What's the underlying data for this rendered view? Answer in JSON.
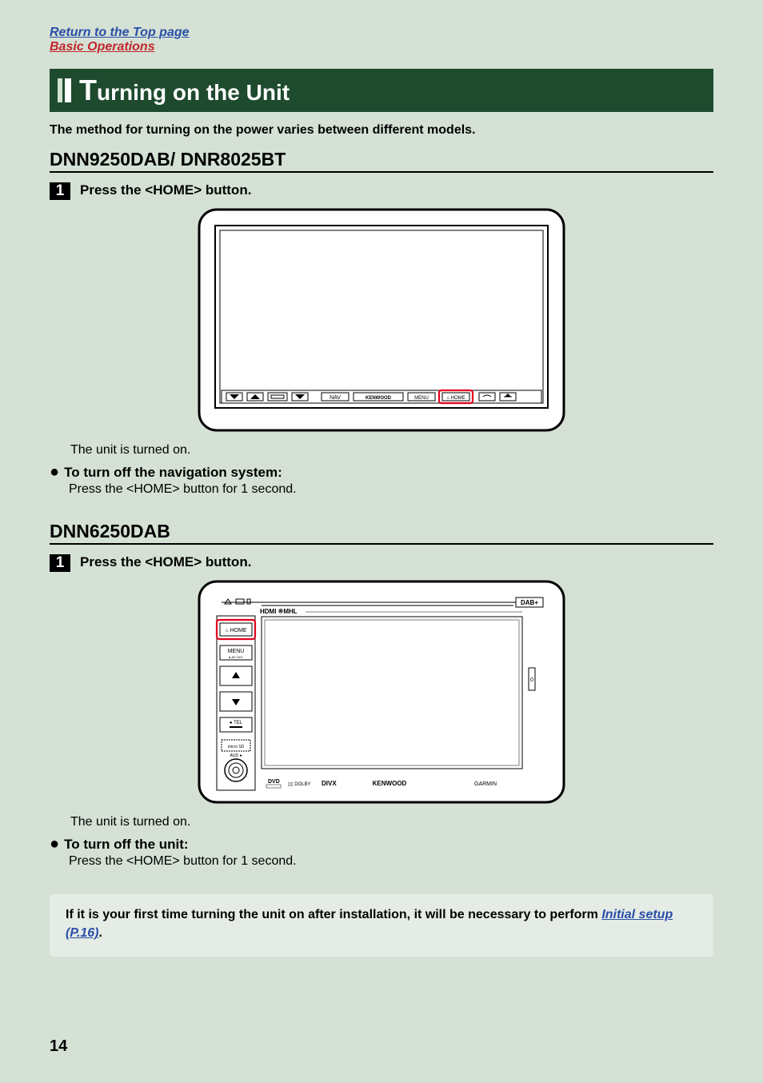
{
  "links": {
    "top_page": "Return to the Top page",
    "basic_ops": "Basic Operations"
  },
  "title": {
    "dropcap": "T",
    "rest": "urning on the Unit"
  },
  "intro": "The method for turning on the power varies between different models.",
  "section1": {
    "heading": "DNN9250DAB/ DNR8025BT",
    "step_num": "1",
    "step_text": "Press the <HOME> button.",
    "result": "The unit is turned on.",
    "bullet_heading": "To turn off the navigation system:",
    "bullet_sub": "Press the <HOME> button for 1 second.",
    "device": {
      "buttons": [
        "NAV",
        "KENWOOD",
        "MENU",
        "HOME"
      ]
    }
  },
  "section2": {
    "heading": "DNN6250DAB",
    "step_num": "1",
    "step_text": "Press the <HOME> button.",
    "result": "The unit is turned on.",
    "bullet_heading": "To turn off the unit:",
    "bullet_sub": "Press the <HOME> button for 1 second.",
    "device": {
      "side_buttons": [
        "HOME",
        "MENU",
        "TEL"
      ],
      "top_label": "HDMI ※MHL",
      "badge": "DAB+",
      "bottom_labels": [
        "DVD",
        "DOLBY",
        "DIVX",
        "KENWOOD",
        "GARMIN"
      ]
    }
  },
  "note": {
    "text_before": "If it is your first time turning the unit on after installation, it will be necessary to perform ",
    "link": "Initial setup (P.16)",
    "text_after": "."
  },
  "page_number": "14"
}
